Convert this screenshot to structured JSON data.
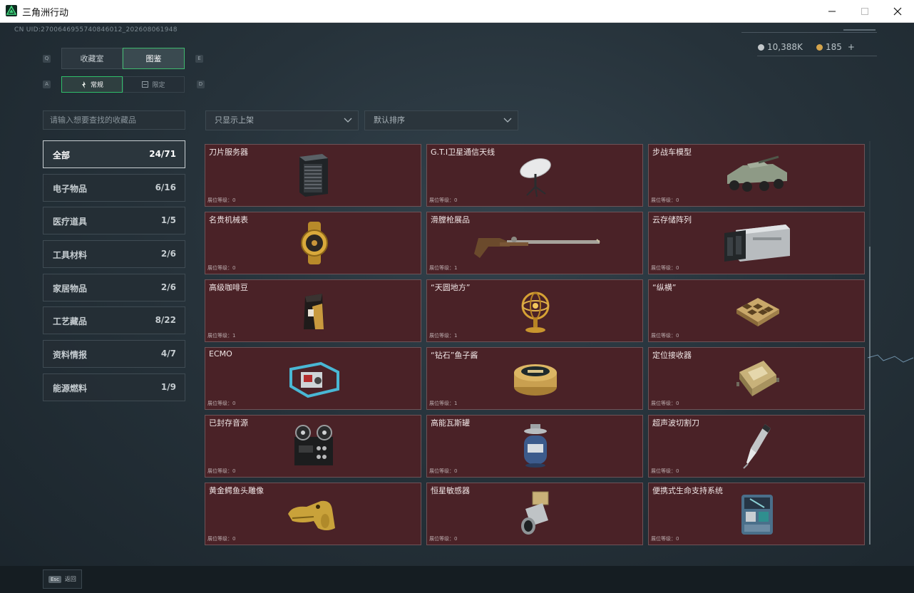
{
  "window": {
    "title": "三角洲行动",
    "controls": [
      "minimize-icon",
      "maximize-icon",
      "close-icon"
    ]
  },
  "header": {
    "uid": "CN UID:2700646955740846012_202608061948",
    "currency": [
      {
        "icon": "silver-coin-icon",
        "value": "10,388K",
        "color": "#c3c8cb"
      },
      {
        "icon": "gold-coin-icon",
        "value": "185",
        "add": "+",
        "color": "#d4a44c"
      }
    ]
  },
  "tabs": {
    "main": [
      {
        "label": "收藏室",
        "key": "Q",
        "active": false
      },
      {
        "label": "图鉴",
        "key": "E",
        "active": true
      }
    ],
    "sub": [
      {
        "label": "常规",
        "key": "A",
        "active": true
      },
      {
        "label": "限定",
        "key": "D",
        "active": false
      }
    ]
  },
  "search": {
    "placeholder": "请输入想要查找的收藏品"
  },
  "filters": {
    "shelf": "只显示上架",
    "sort": "默认排序"
  },
  "categories": [
    {
      "name": "全部",
      "count": "24/71",
      "active": true
    },
    {
      "name": "电子物品",
      "count": "6/16"
    },
    {
      "name": "医疗道具",
      "count": "1/5"
    },
    {
      "name": "工具材料",
      "count": "2/6"
    },
    {
      "name": "家居物品",
      "count": "2/6"
    },
    {
      "name": "工艺藏品",
      "count": "8/22"
    },
    {
      "name": "资料情报",
      "count": "4/7"
    },
    {
      "name": "能源燃料",
      "count": "1/9"
    }
  ],
  "items": [
    {
      "name": "刀片服务器",
      "level": "展位等级：0",
      "icon": "blade-server-icon"
    },
    {
      "name": "G.T.I卫星通信天线",
      "level": "展位等级：0",
      "icon": "satellite-dish-icon"
    },
    {
      "name": "步战车模型",
      "level": "展位等级：0",
      "icon": "armored-vehicle-icon"
    },
    {
      "name": "名贵机械表",
      "level": "展位等级：0",
      "icon": "gold-watch-icon"
    },
    {
      "name": "滑膛枪展品",
      "level": "展位等级：1",
      "icon": "musket-icon"
    },
    {
      "name": "云存储阵列",
      "level": "展位等级：0",
      "icon": "storage-array-icon"
    },
    {
      "name": "高级咖啡豆",
      "level": "展位等级：1",
      "icon": "coffee-bag-icon"
    },
    {
      "name": "“天圆地方”",
      "level": "展位等级：1",
      "icon": "armillary-sphere-icon"
    },
    {
      "name": "“纵横”",
      "level": "展位等级：0",
      "icon": "chess-board-icon"
    },
    {
      "name": "ECMO",
      "level": "展位等级：0",
      "icon": "ecmo-machine-icon"
    },
    {
      "name": "“钻石”鱼子酱",
      "level": "展位等级：1",
      "icon": "caviar-tin-icon"
    },
    {
      "name": "定位接收器",
      "level": "展位等级：0",
      "icon": "gps-receiver-icon"
    },
    {
      "name": "已封存音源",
      "level": "展位等级：0",
      "icon": "tape-recorder-icon"
    },
    {
      "name": "高能瓦斯罐",
      "level": "展位等级：0",
      "icon": "gas-canister-icon"
    },
    {
      "name": "超声波切割刀",
      "level": "展位等级：0",
      "icon": "ultrasonic-cutter-icon"
    },
    {
      "name": "黄金鳄鱼头雕像",
      "level": "展位等级：0",
      "icon": "gold-crocodile-icon"
    },
    {
      "name": "恒星敏感器",
      "level": "展位等级：0",
      "icon": "star-sensor-icon"
    },
    {
      "name": "便携式生命支持系统",
      "level": "展位等级：0",
      "icon": "life-support-icon"
    }
  ],
  "footer": {
    "esc_key": "Esc",
    "back_label": "返回"
  },
  "colors": {
    "card_bg": "#4a2227",
    "card_border": "#6e5357",
    "active_border": "#c9d0d3",
    "accent_green": "#2fbf6a"
  }
}
